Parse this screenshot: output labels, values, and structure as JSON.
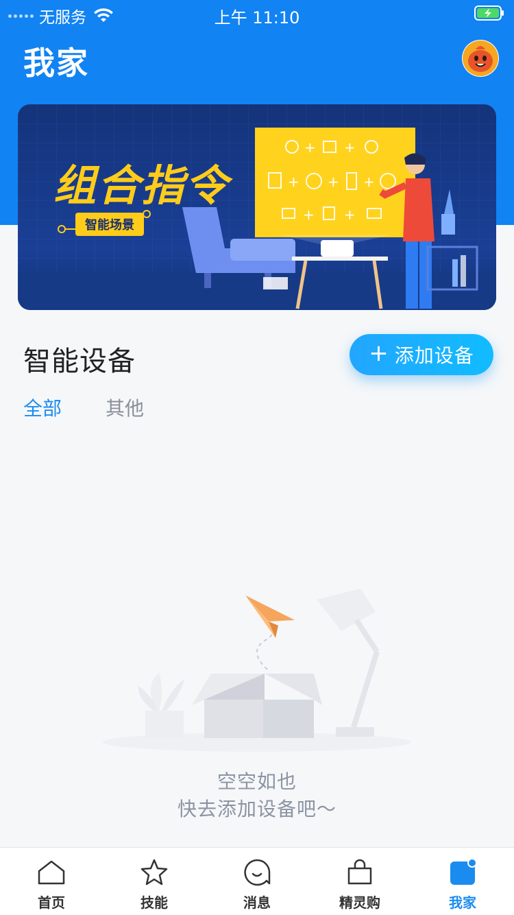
{
  "status_bar": {
    "carrier": "无服务",
    "time": "上午 11:10"
  },
  "header": {
    "title": "我家"
  },
  "banner": {
    "title": "组合指令",
    "tag": "智能场景"
  },
  "devices": {
    "section_title": "智能设备",
    "add_button_label": "添加设备",
    "tabs": [
      {
        "label": "全部",
        "active": true
      },
      {
        "label": "其他",
        "active": false
      }
    ],
    "empty_title": "空空如也",
    "empty_subtitle": "快去添加设备吧～"
  },
  "tab_bar": {
    "items": [
      {
        "label": "首页",
        "icon": "home-icon",
        "active": false
      },
      {
        "label": "技能",
        "icon": "star-icon",
        "active": false
      },
      {
        "label": "消息",
        "icon": "message-icon",
        "active": false
      },
      {
        "label": "精灵购",
        "icon": "shopping-bag-icon",
        "active": false
      },
      {
        "label": "我家",
        "icon": "my-home-icon",
        "active": true
      }
    ]
  },
  "colors": {
    "primary": "#1183f3",
    "accent": "#1a8cf0",
    "banner_yellow": "#ffcc1a"
  }
}
